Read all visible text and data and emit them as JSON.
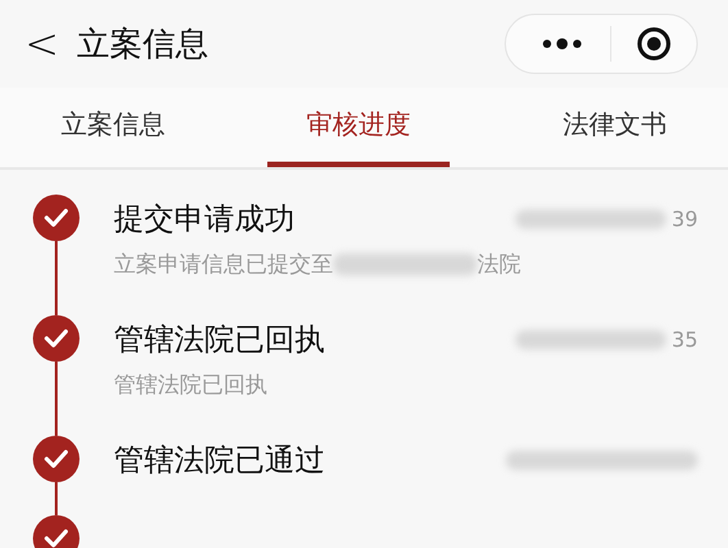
{
  "nav": {
    "back": "<",
    "title": "立案信息"
  },
  "tabs": [
    {
      "label": "立案信息",
      "selected": false
    },
    {
      "label": "审核进度",
      "selected": true
    },
    {
      "label": "法律文书",
      "selected": false
    }
  ],
  "steps": [
    {
      "done": true,
      "title": "提交申请成功",
      "time_tail": "39",
      "description_before": "立案申请信息已提交至",
      "description_after": "法院",
      "redacted": true
    },
    {
      "done": true,
      "title": "管辖法院已回执",
      "time_tail": "35",
      "description_before": "管辖法院已回执"
    },
    {
      "done": true,
      "title": "管辖法院已通过"
    },
    {
      "done": true
    }
  ]
}
